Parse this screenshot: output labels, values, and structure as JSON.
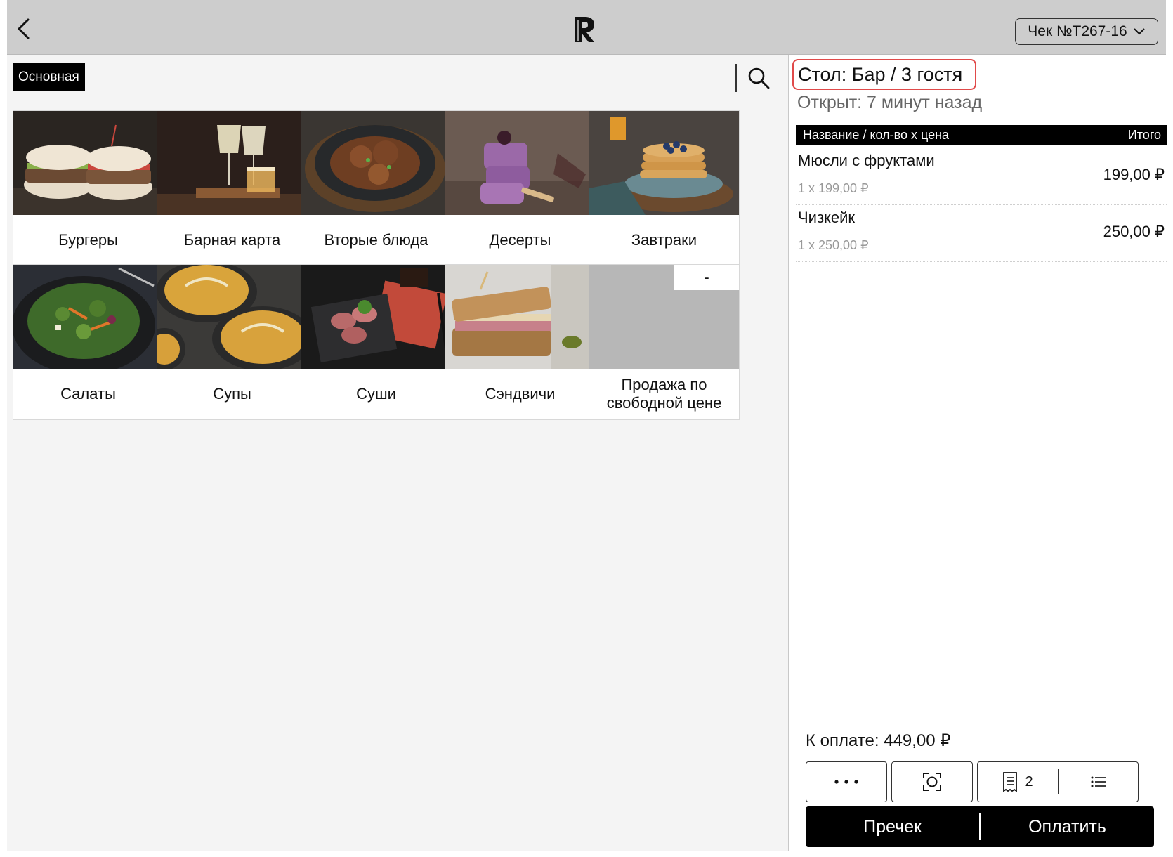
{
  "header": {
    "receipt_label": "Чек №Т267-16"
  },
  "menu": {
    "category_tab": "Основная",
    "tiles": [
      {
        "label": "Бургеры"
      },
      {
        "label": "Барная карта"
      },
      {
        "label": "Вторые блюда"
      },
      {
        "label": "Десерты"
      },
      {
        "label": "Завтраки"
      },
      {
        "label": "Салаты"
      },
      {
        "label": "Супы"
      },
      {
        "label": "Суши"
      },
      {
        "label": "Сэндвичи"
      },
      {
        "label": "Продажа по свободной цене",
        "badge": "-"
      }
    ]
  },
  "order": {
    "table": "Стол: Бар / 3 гостя",
    "opened": "Открыт: 7 минут назад",
    "columns": {
      "name": "Название / кол-во х цена",
      "total": "Итого"
    },
    "items": [
      {
        "name": "Мюсли с фруктами",
        "qty": "1 x 199,00 ₽",
        "total": "199,00 ₽"
      },
      {
        "name": "Чизкейк",
        "qty": "1 x 250,00 ₽",
        "total": "250,00 ₽"
      }
    ],
    "to_pay": "К оплате: 449,00 ₽",
    "receipts_count": "2",
    "precheck_label": "Пречек",
    "pay_label": "Оплатить"
  },
  "colors": {
    "topbar": "#cdcdcd",
    "accent": "#000000",
    "highlight": "#e04a4a"
  }
}
